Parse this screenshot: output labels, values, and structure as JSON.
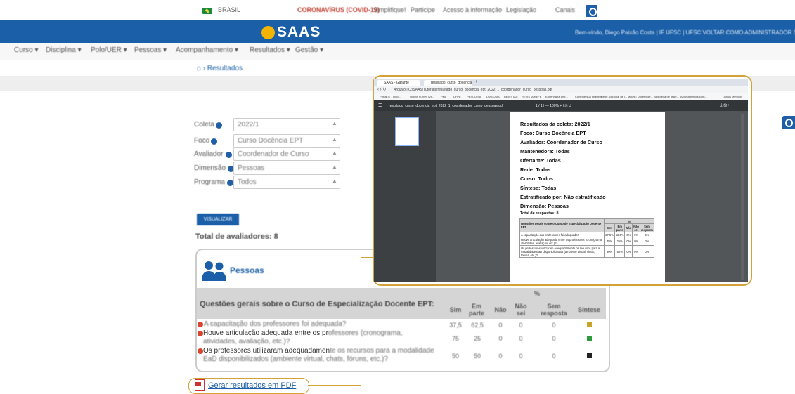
{
  "gov_bar": {
    "country": "BRASIL",
    "links": [
      "CORONAVÍRUS (COVID-19)",
      "Simplifique!",
      "Participe",
      "Acesso à informação",
      "Legislação",
      "Canais"
    ]
  },
  "header": {
    "logo": "SAAS",
    "user_info": "Bem-vindo, Diego Paixão Costa  |  IF UFSC  |  UFSC   VOLTAR COMO ADMINISTRADOR   SAIR"
  },
  "menu": [
    "Curso ▾",
    "Disciplina ▾",
    "Polo/UER ▾",
    "Pessoas ▾",
    "Acompanhamento ▾",
    "Resultados ▾",
    "Gestão ▾"
  ],
  "breadcrumb": "⌂ › Resultados",
  "form": {
    "fields": [
      {
        "label": "Coleta",
        "value": "2022/1"
      },
      {
        "label": "Foco",
        "value": "Curso Docência EPT"
      },
      {
        "label": "Avaliador",
        "value": "Coordenador de Curso"
      },
      {
        "label": "Dimensão",
        "value": "Pessoas"
      },
      {
        "label": "Programa",
        "value": "Todos"
      }
    ],
    "submit_label": "VISUALIZAR"
  },
  "results": {
    "total_label": "Total de avaliadores: 8",
    "section_title": "Pessoas",
    "question_header": "Questões gerais sobre o Curso de Especialização Docente EPT:",
    "percent_label": "%",
    "columns": [
      "Sim",
      "Em parte",
      "Não",
      "Não sei",
      "Sem resposta",
      "Síntese"
    ],
    "rows": [
      {
        "q_main": "A capacitação dos professores foi adequada?",
        "q_tail": "",
        "values": [
          "37,5",
          "62,5",
          "0",
          "0",
          "0"
        ],
        "synth_color": "#c9a227"
      },
      {
        "q_main": "Houve articulação adequada entre os pr",
        "q_tail": "ofessores (cronograma, atividades, avaliação, etc.)?",
        "values": [
          "75",
          "25",
          "0",
          "0",
          "0"
        ],
        "synth_color": "#2e9b3a"
      },
      {
        "q_main": "Os professores utilizaram adequadamen",
        "q_tail": "te os recursos para a modalidade EaD disponibilizados (ambiente virtual, chats, fóruns, etc.)?",
        "values": [
          "50",
          "50",
          "0",
          "0",
          "0"
        ],
        "synth_color": "#222222"
      }
    ]
  },
  "pdf_link": "Gerar resultados em PDF",
  "inset": {
    "tabs": [
      "SAAS - Garante",
      "resultado_curso_docencia_ept_2",
      "+"
    ],
    "address": "Arquivo  |  C:/SAAS/Tutoriais/resultado_curso_docencia_ept_2022_1_coordenador_curso_pessoas.pdf",
    "bookmarks": [
      "Portal IE - Ingo...",
      "Online Survey (2n...",
      "Pelo",
      "UFPE",
      "PESQUISA",
      "LOGIOMA",
      "REVISTAS",
      "REVISTA REFE",
      "Engenharia Dist...",
      "Controle sua imagem",
      "Rede Nacional de l...",
      "Mikos | Unifesv de...",
      "Biblioteca de teste...",
      "Apontamentos com...",
      "Outros favoritos"
    ],
    "pdf_filename": "resultado_curso_docencia_ept_2022_1_coordenador_curso_pessoas.pdf",
    "pdf_pageinfo": "1 / 1   |   —   100%   +   |   ⊡   ↺",
    "thumb_page": "1",
    "doc_lines": [
      "Resultados da coleta: 2022/1",
      "Foco: Curso Docência EPT",
      "Avaliador: Coordenador de Curso",
      "Mantenedora: Todas",
      "Ofertante: Todas",
      "Rede: Todas",
      "Curso: Todos",
      "Síntese: Todas",
      "Estratificado por: Não estratificado",
      "Dimensão: Pessoas"
    ],
    "total_respostas": "Total de respostas: 8",
    "table": {
      "question_header": "Questões gerais sobre o Curso de Especialização Docente EPT",
      "percent_label": "%",
      "columns": [
        "Sim",
        "Em parte",
        "Não",
        "Não sei",
        "Sem resposta"
      ],
      "rows": [
        {
          "q": "A capacitação dos professores foi adequada?",
          "values": [
            "37.5%",
            "62.5%",
            "0%",
            "0%",
            "0%"
          ]
        },
        {
          "q": "Houve articulação adequada entre os professores (cronograma, atividades, avaliação, etc.)?",
          "values": [
            "75%",
            "25%",
            "0%",
            "0%",
            "0%"
          ]
        },
        {
          "q": "Os professores utilizaram adequadamente os recursos para a modalidade EaD disponibilizados (ambiente virtual, chats, fóruns, etc.)?",
          "values": [
            "50%",
            "50%",
            "0%",
            "0%",
            "0%"
          ]
        }
      ]
    }
  },
  "colors": {
    "primary": "#1a5fa7",
    "accent_outline": "#d4a23a",
    "logo_yellow": "#f5b400"
  }
}
